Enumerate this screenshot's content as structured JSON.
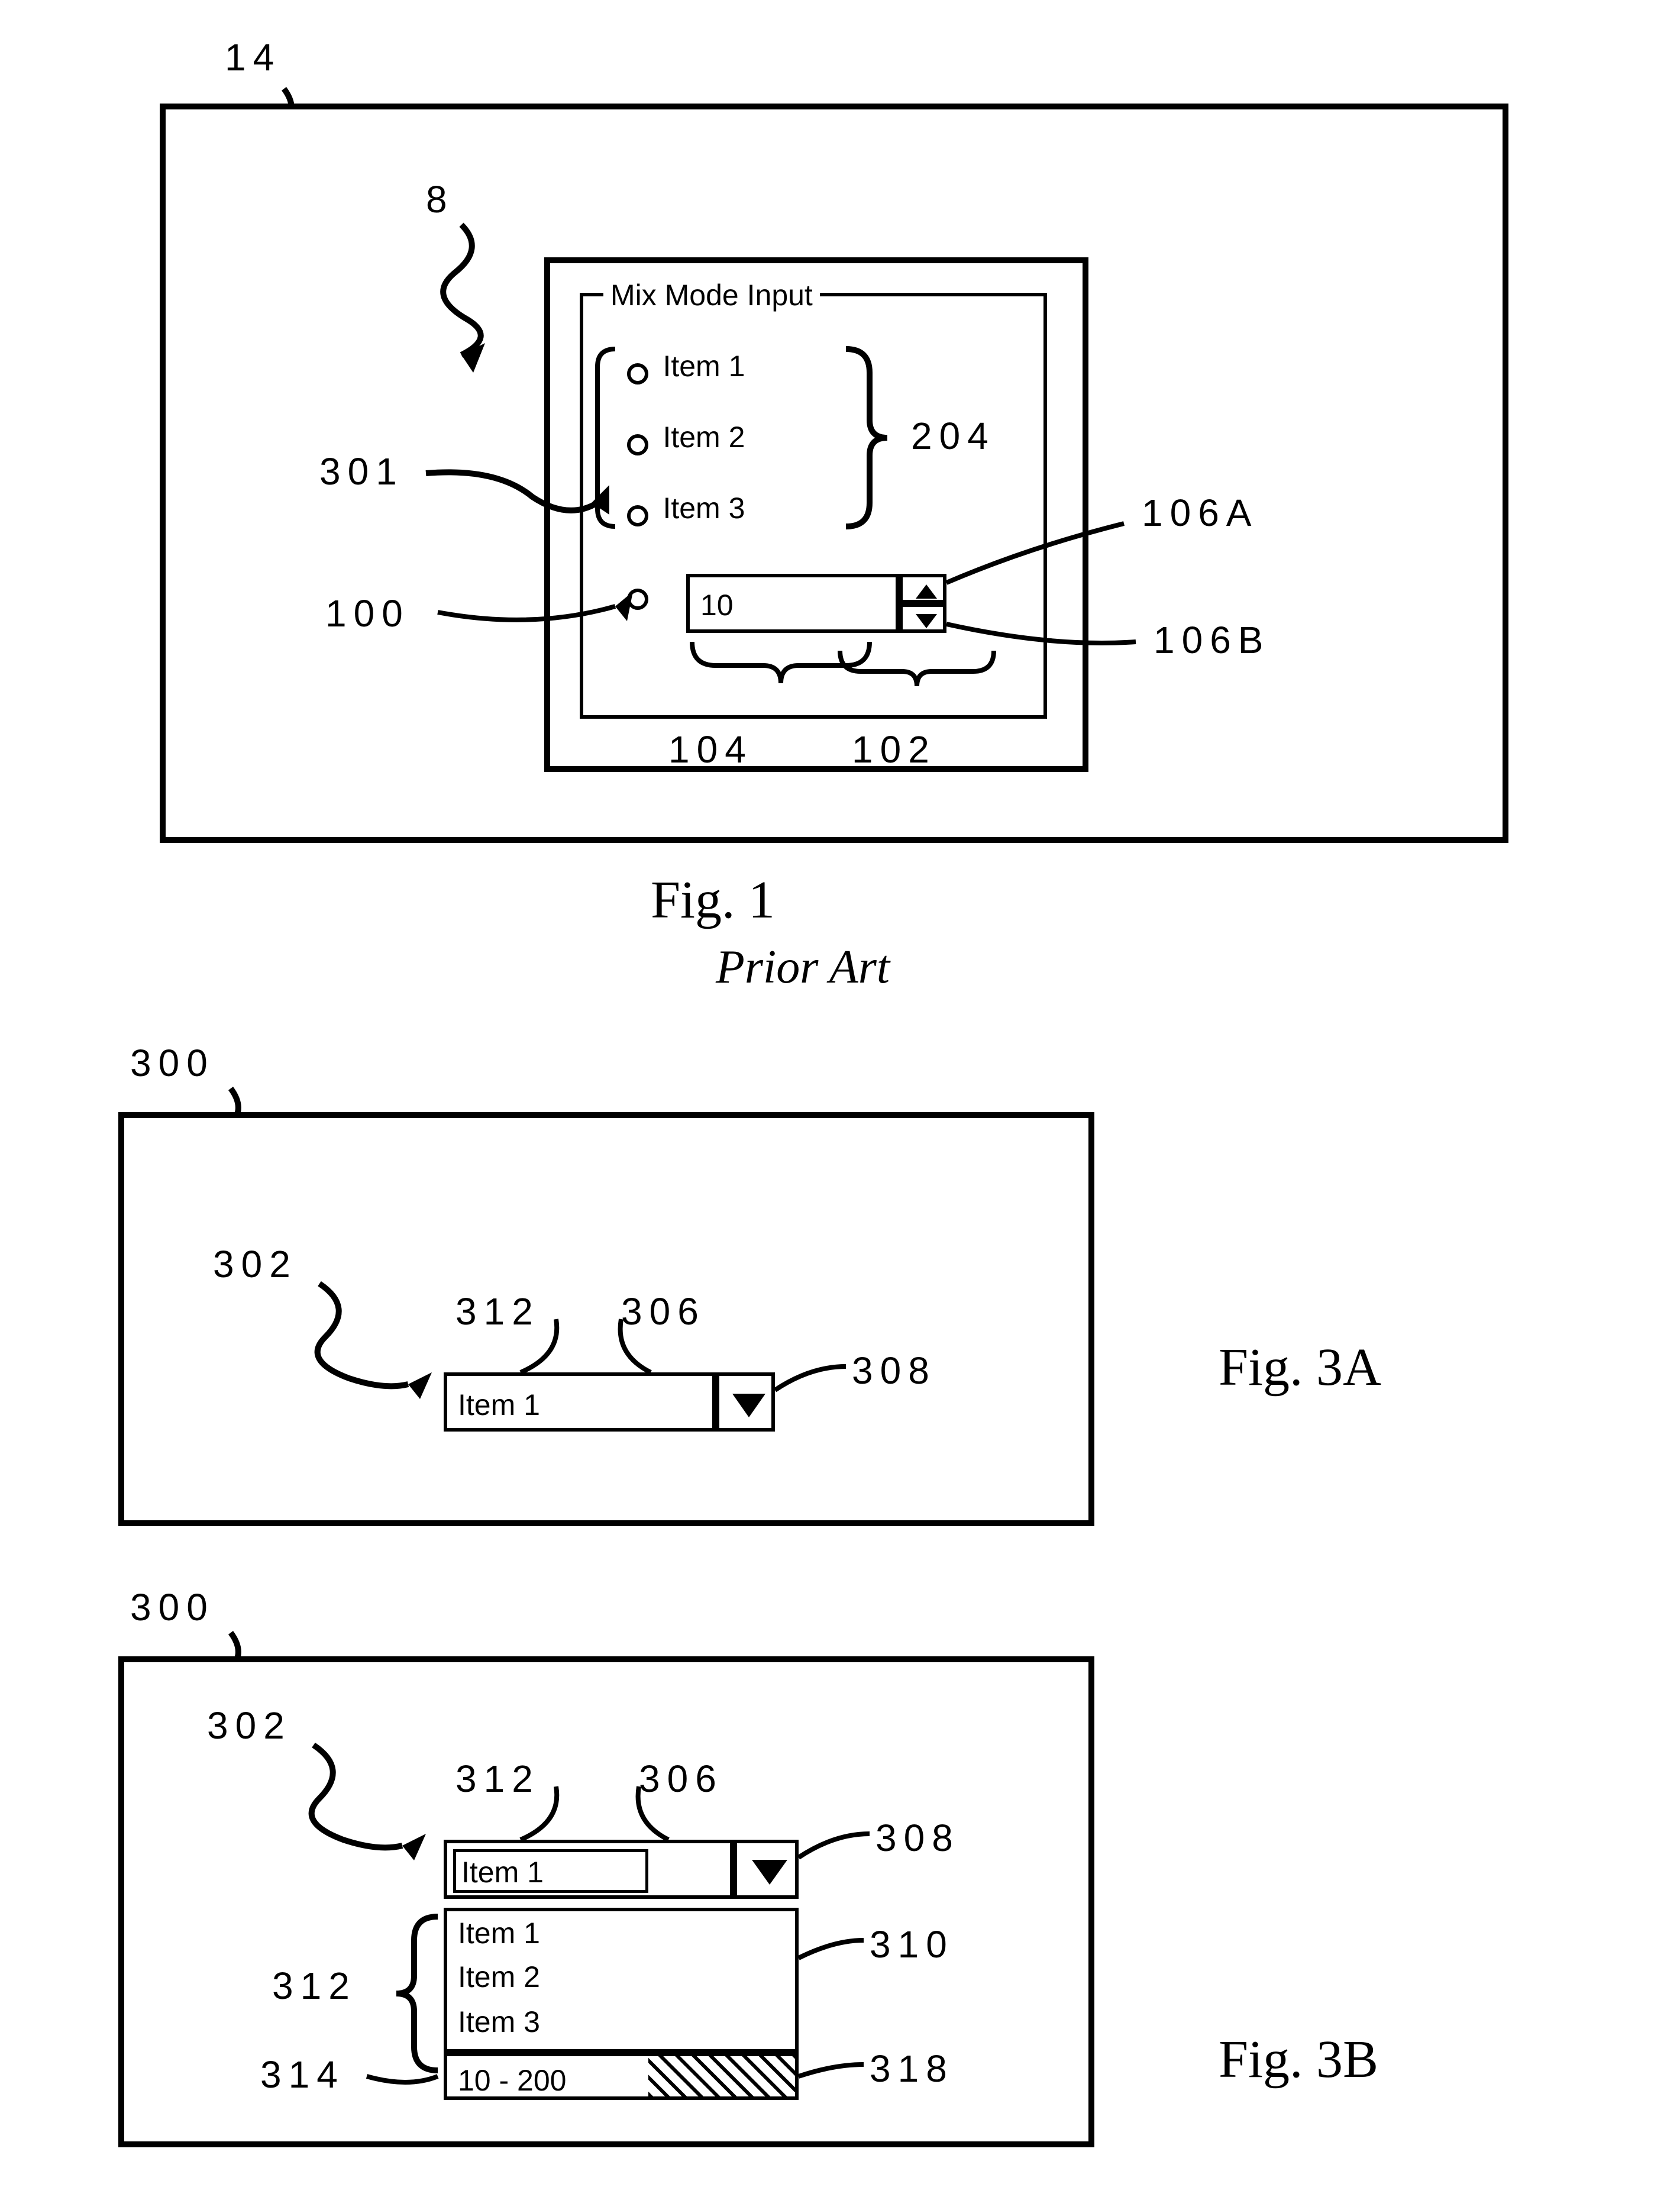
{
  "fig1": {
    "refs": {
      "outer": "14",
      "inner": "8",
      "r204": "204",
      "r301": "301",
      "r106A": "106A",
      "r100": "100",
      "r106B": "106B",
      "r104": "104",
      "r102": "102"
    },
    "group_title": "Mix Mode Input",
    "items": [
      "Item 1",
      "Item 2",
      "Item 3"
    ],
    "spin_value": "10",
    "caption_line1": "Fig.  1",
    "caption_line2": "Prior Art"
  },
  "fig3a": {
    "refs": {
      "outer": "300",
      "r302": "302",
      "r312": "312",
      "r306": "306",
      "r308": "308"
    },
    "field_value": "Item 1",
    "caption": "Fig.  3A"
  },
  "fig3b": {
    "refs": {
      "outer": "300",
      "r302": "302",
      "r312_top": "312",
      "r306": "306",
      "r308": "308",
      "r312_side": "312",
      "r310": "310",
      "r314": "314",
      "r318": "318"
    },
    "field_value": "Item 1",
    "list": [
      "Item 1",
      "Item 2",
      "Item 3"
    ],
    "range_value": "10 - 200",
    "caption": "Fig.  3B"
  }
}
